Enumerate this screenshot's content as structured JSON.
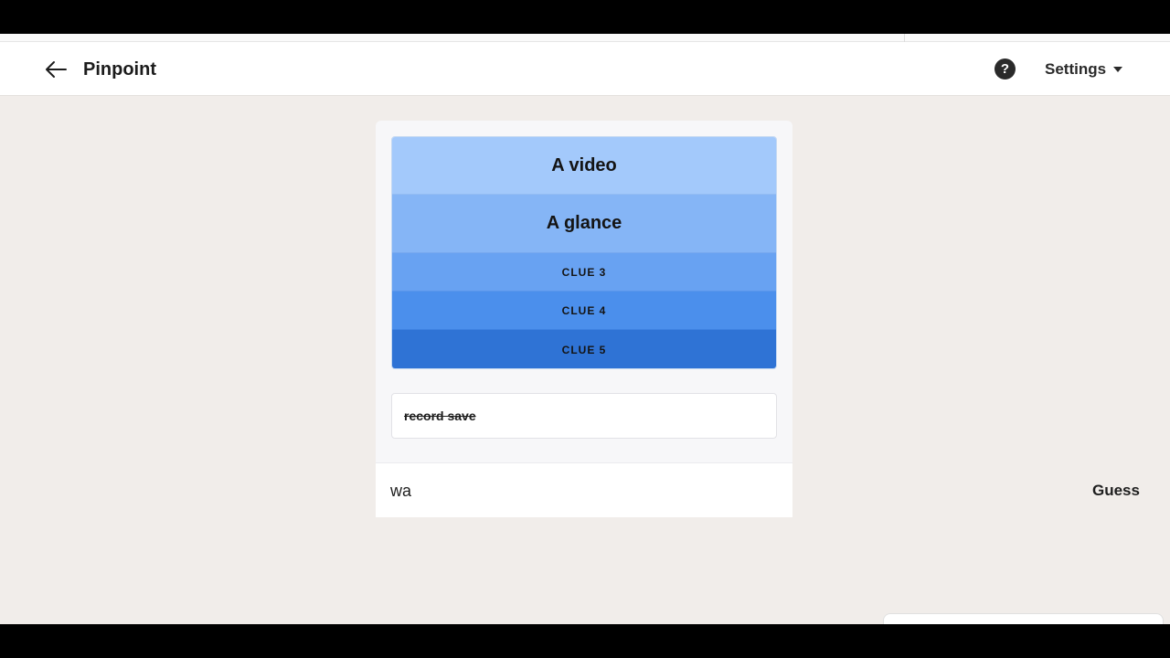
{
  "header": {
    "title": "Pinpoint",
    "settings_label": "Settings",
    "help_glyph": "?"
  },
  "icons": {
    "back": "arrow-left-icon",
    "help": "question-circle-icon",
    "settings_caret": "caret-down-icon"
  },
  "clues": [
    {
      "label": "A video",
      "revealed": true,
      "color": "#a3c9fb"
    },
    {
      "label": "A glance",
      "revealed": true,
      "color": "#85b5f6"
    },
    {
      "label": "CLUE 3",
      "revealed": false,
      "color": "#68a2f2"
    },
    {
      "label": "CLUE 4",
      "revealed": false,
      "color": "#4b8fec"
    },
    {
      "label": "CLUE 5",
      "revealed": false,
      "color": "#2f73d5"
    }
  ],
  "previous_guesses": [
    {
      "text": "record save",
      "correct": false
    }
  ],
  "guess_form": {
    "input_value": "wa",
    "button_label": "Guess"
  },
  "colors": {
    "background": "#f1edea",
    "header_bg": "#ffffff",
    "card_bg": "#f7f7f9"
  }
}
